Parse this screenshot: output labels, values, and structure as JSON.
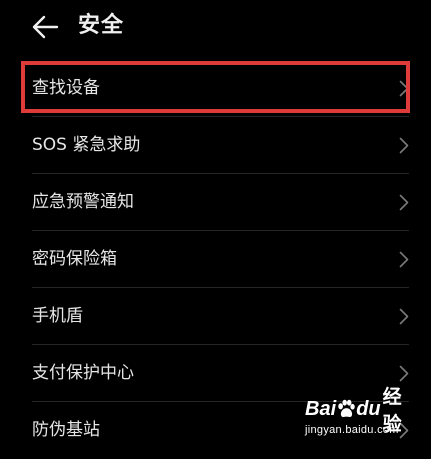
{
  "header": {
    "back_icon": "arrow-left-icon",
    "title": "安全"
  },
  "menu": {
    "items": [
      {
        "label": "查找设备",
        "icon": "chevron-right-icon",
        "highlighted": true
      },
      {
        "label": "SOS 紧急求助",
        "icon": "chevron-right-icon"
      },
      {
        "label": "应急预警通知",
        "icon": "chevron-right-icon"
      },
      {
        "label": "密码保险箱",
        "icon": "chevron-right-icon"
      },
      {
        "label": "手机盾",
        "icon": "chevron-right-icon"
      },
      {
        "label": "支付保护中心",
        "icon": "chevron-right-icon"
      },
      {
        "label": "防伪基站",
        "icon": "chevron-right-icon"
      }
    ]
  },
  "annotation": {
    "color": "#e03b3b"
  },
  "watermark": {
    "brand_part1": "Bai",
    "brand_part2": "du",
    "brand_suffix": "经验",
    "url": "jingyan.baidu.com"
  },
  "colors": {
    "background": "#000000",
    "text": "#e6e6e6",
    "chevron": "#7a7a7a",
    "divider": "#262626"
  }
}
